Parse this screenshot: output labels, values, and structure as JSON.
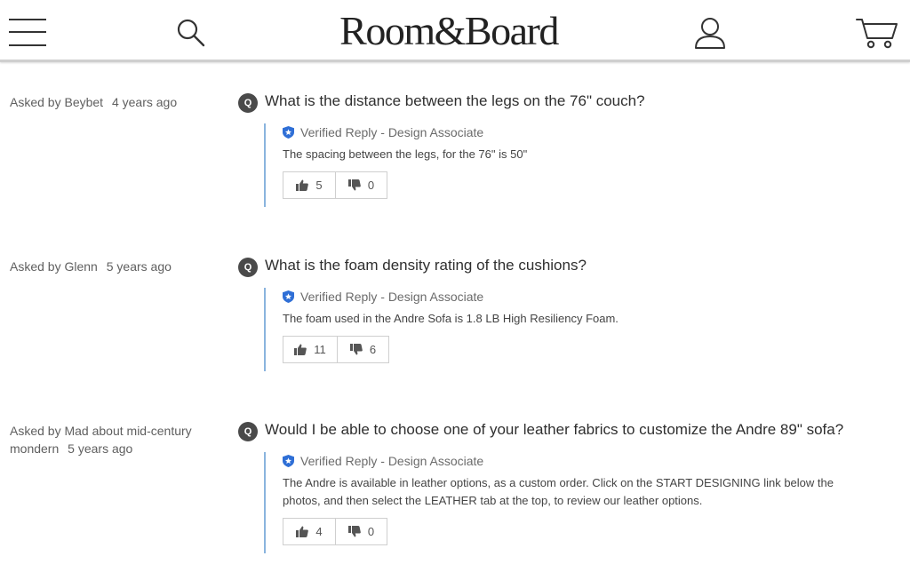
{
  "header": {
    "logo": "Room&Board",
    "icons": [
      "menu-icon",
      "search-icon",
      "account-icon",
      "cart-icon"
    ]
  },
  "qa": [
    {
      "asked_by_label": "Asked by",
      "author": "Beybet",
      "time": "4 years ago",
      "badge": "Q",
      "question": "What is the distance between the legs on the 76\" couch?",
      "reply_label": "Verified Reply - Design Associate",
      "reply_text": "The spacing between the legs, for the 76\" is 50\"",
      "upvotes": "5",
      "downvotes": "0"
    },
    {
      "asked_by_label": "Asked by",
      "author": "Glenn",
      "time": "5 years ago",
      "badge": "Q",
      "question": "What is the foam density rating of the cushions?",
      "reply_label": "Verified Reply - Design Associate",
      "reply_text": "The foam used in the Andre Sofa is 1.8 LB High Resiliency Foam.",
      "upvotes": "11",
      "downvotes": "6"
    },
    {
      "asked_by_label": "Asked by",
      "author": "Mad about mid-century mondern",
      "time": "5 years ago",
      "badge": "Q",
      "question": "Would I be able to choose one of your leather fabrics to customize the Andre 89\" sofa?",
      "reply_label": "Verified Reply - Design Associate",
      "reply_text": "The Andre is available in leather options, as a custom order. Click on the START DESIGNING link below the photos, and then select the LEATHER tab at the top, to review our leather options.",
      "upvotes": "4",
      "downvotes": "0"
    }
  ],
  "colors": {
    "reply_border": "#8ab4de",
    "shield": "#2f6fd6",
    "badge": "#4a4a4a"
  }
}
